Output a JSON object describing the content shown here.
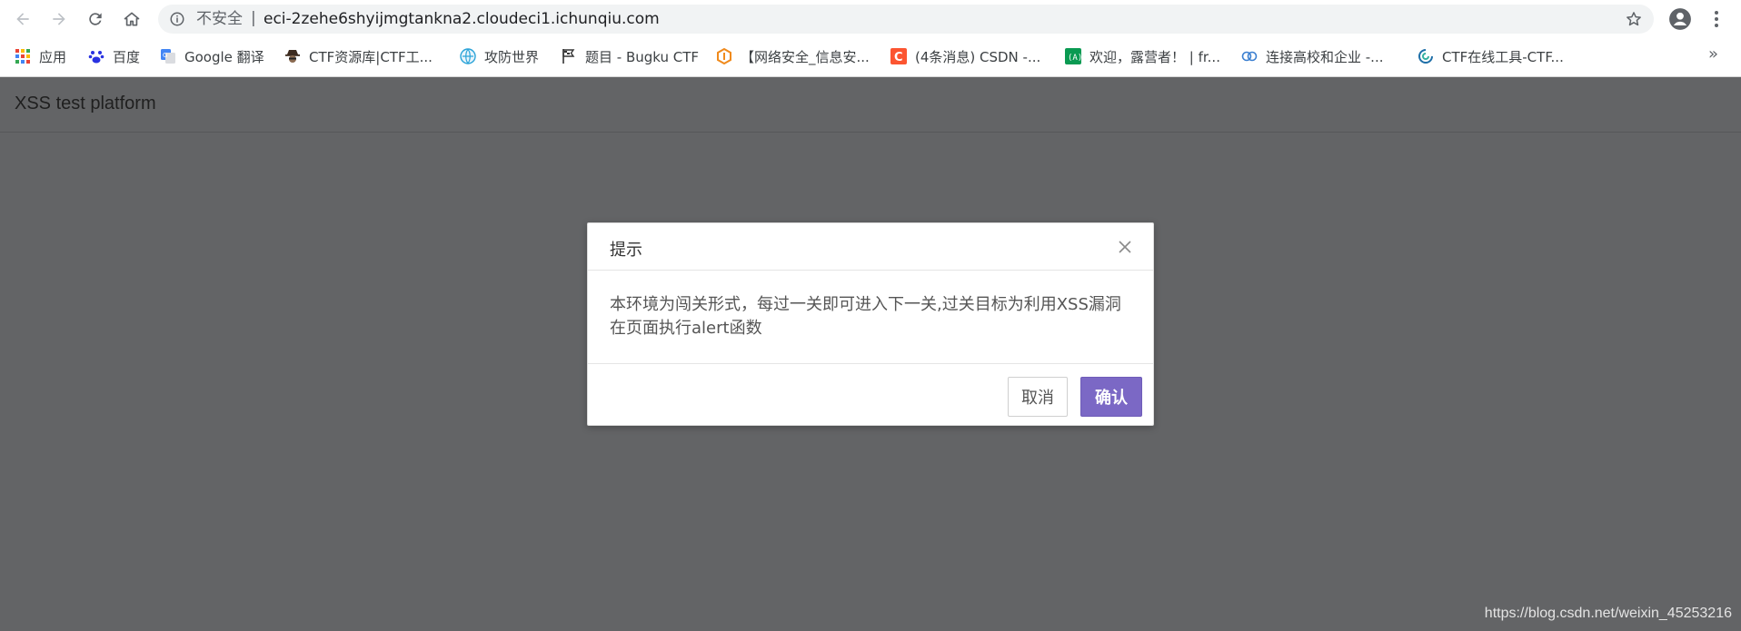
{
  "browser": {
    "security_label": "不安全",
    "separator": "|",
    "url": "eci-2zehe6shyijmgtankna2.cloudeci1.ichunqiu.com",
    "icons": [
      "back-arrow-icon",
      "forward-arrow-icon",
      "reload-icon",
      "home-icon",
      "info-icon",
      "star-icon",
      "profile-icon",
      "menu-dots-icon"
    ]
  },
  "bookmarks": {
    "items": [
      {
        "label": "应用",
        "icon": "apps-grid-icon"
      },
      {
        "label": "百度",
        "icon": "baidu-paw-icon"
      },
      {
        "label": "Google 翻译",
        "icon": "google-translate-icon"
      },
      {
        "label": "CTF资源库|CTF工...",
        "icon": "spy-icon"
      },
      {
        "label": "攻防世界",
        "icon": "globe-icon"
      },
      {
        "label": "题目 - Bugku CTF",
        "icon": "flag-icon"
      },
      {
        "label": "【网络安全_信息安...",
        "icon": "cube-icon"
      },
      {
        "label": "(4条消息) CSDN -...",
        "icon": "csdn-c-icon"
      },
      {
        "label": "欢迎，露营者！ | fr...",
        "icon": "freecodecamp-icon"
      },
      {
        "label": "连接高校和企业 -...",
        "icon": "cloud-icon"
      },
      {
        "label": "CTF在线工具-CTF...",
        "icon": "swirl-icon"
      }
    ],
    "more": "»"
  },
  "page": {
    "title": "XSS test platform"
  },
  "modal": {
    "title": "提示",
    "body": "本环境为闯关形式，每过一关即可进入下一关,过关目标为利用XSS漏洞在页面执行alert函数",
    "cancel_label": "取消",
    "ok_label": "确认"
  },
  "watermark": "https://blog.csdn.net/weixin_45253216",
  "colors": {
    "overlay": "#636466",
    "primary_button": "#7b68c5"
  }
}
